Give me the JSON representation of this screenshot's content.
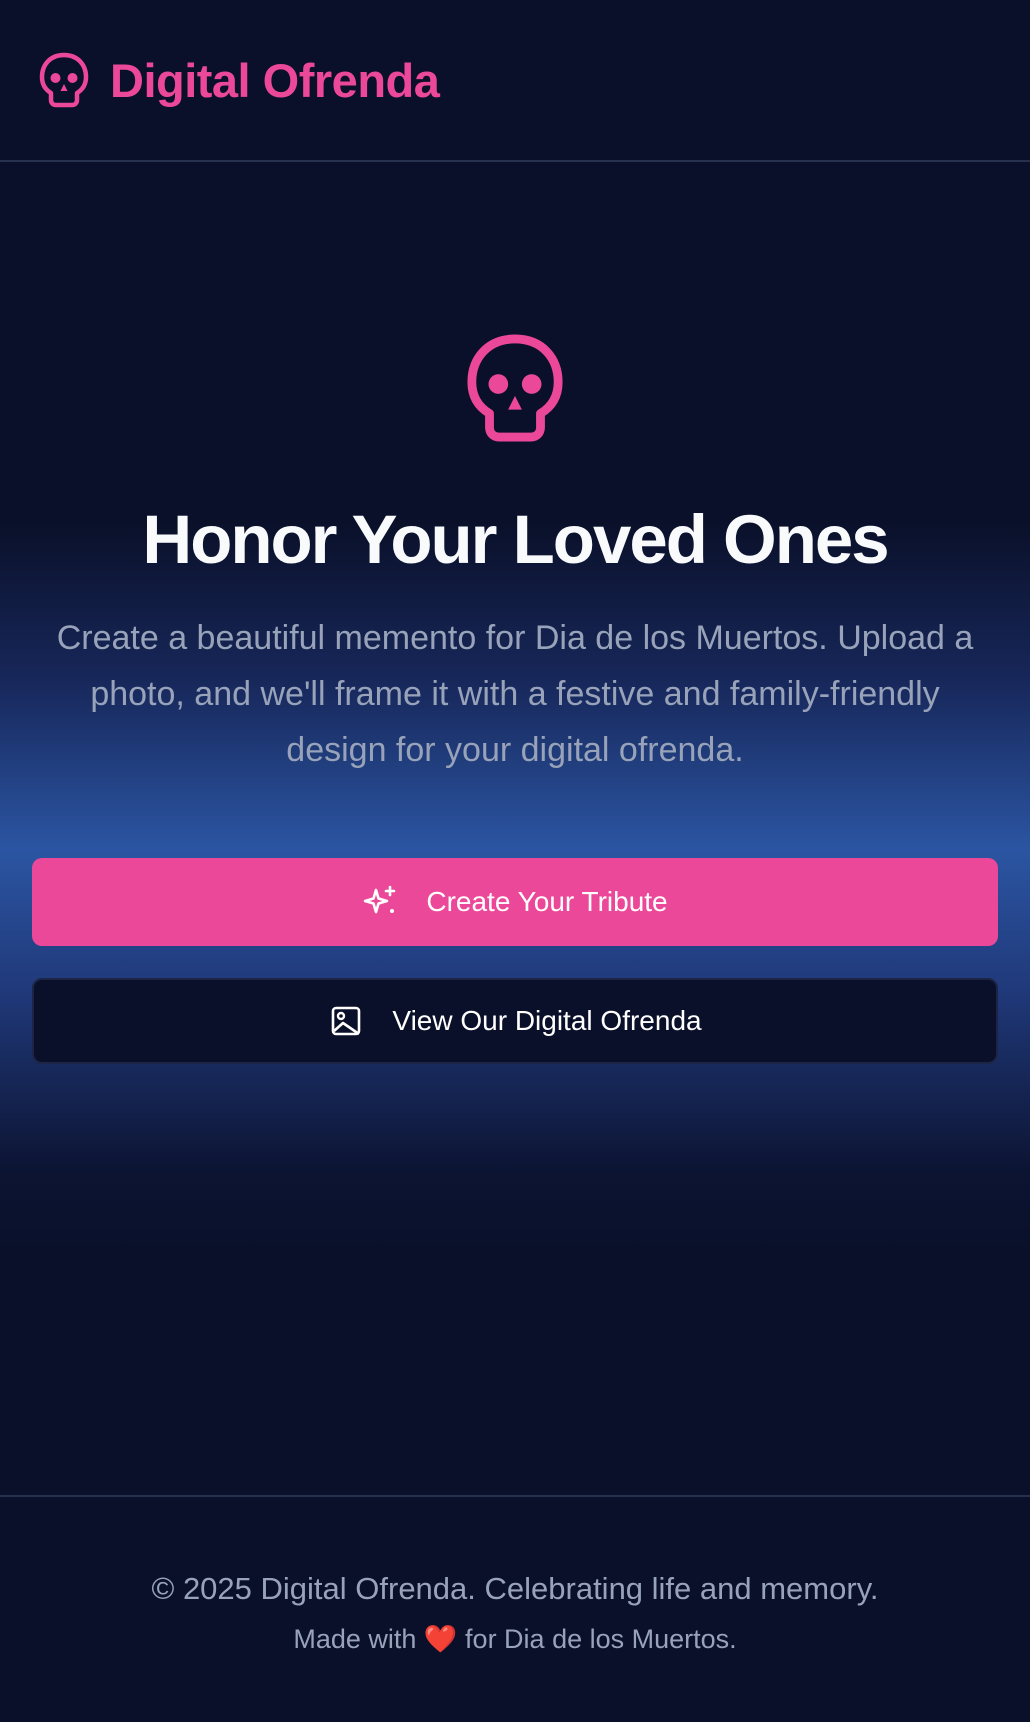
{
  "header": {
    "logo_icon": "skull-icon",
    "brand": "Digital Ofrenda"
  },
  "hero": {
    "icon": "skull-icon",
    "title": "Honor Your Loved Ones",
    "subtitle": "Create a beautiful memento for Dia de los Muertos. Upload a photo, and we'll frame it with a festive and family-friendly design for your digital ofrenda."
  },
  "actions": {
    "primary_label": "Create Your Tribute",
    "primary_icon": "sparkles-icon",
    "secondary_label": "View Our Digital Ofrenda",
    "secondary_icon": "image-icon"
  },
  "footer": {
    "copyright": "© 2025 Digital Ofrenda. Celebrating life and memory.",
    "made_prefix": "Made with",
    "heart": "❤️",
    "made_suffix": "for Dia de los Muertos."
  },
  "colors": {
    "accent": "#ec4899",
    "background": "#0a1029",
    "glow": "#2b55a2",
    "muted_text": "#98a3ba"
  }
}
